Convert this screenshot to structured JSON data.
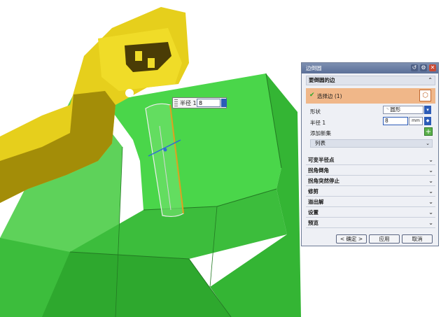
{
  "viewport": {
    "floating_input": {
      "label": "半径 1",
      "value": "8"
    }
  },
  "dialog": {
    "title": "边倒圆",
    "section_edges": {
      "header": "要倒圆的边",
      "select_edge_label": "选择边 (1)",
      "shape_label": "形状",
      "shape_value": "圆形",
      "radius_label": "半径 1",
      "radius_value": "8",
      "radius_unit": "mm",
      "add_set_label": "添加新集",
      "list_label": "列表"
    },
    "collapsed_sections": [
      "可变半径点",
      "拐角倒角",
      "拐角突然停止",
      "修剪",
      "溢出解",
      "设置",
      "预览"
    ],
    "buttons": {
      "ok": "< 确定 >",
      "apply": "应用",
      "cancel": "取消"
    }
  },
  "colors": {
    "part_yellow": "#e8d31c",
    "block_green": "#3fcf3a",
    "dialog_title": "#6a7ea6",
    "selection_orange": "#f0b789"
  }
}
